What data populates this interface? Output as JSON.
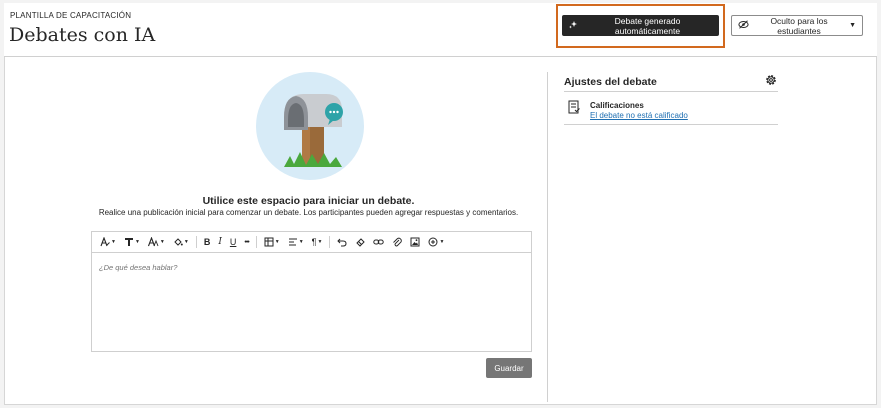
{
  "header": {
    "breadcrumb": "PLANTILLA DE CAPACITACIÓN",
    "title": "Debates con IA",
    "ai_button_label": "Debate generado automáticamente",
    "visibility_label": "Oculto para los estudiantes"
  },
  "main": {
    "prompt_title": "Utilice este espacio para iniciar un debate.",
    "prompt_subtitle": "Realice una publicación inicial para comenzar un debate. Los participantes pueden agregar respuestas y comentarios.",
    "editor_placeholder": "¿De qué desea hablar?",
    "toolbar": {
      "bold": "B",
      "italic": "I",
      "underline": "U",
      "more": "•••",
      "paragraph": "¶"
    },
    "save_label": "Guardar"
  },
  "settings": {
    "title": "Ajustes del debate",
    "grades_label": "Calificaciones",
    "grades_link": "El debate no está calificado"
  },
  "colors": {
    "highlight": "#d2691e",
    "primary_button": "#262626",
    "save_button": "#767676",
    "link": "#1f6fb2",
    "illustration_bg": "#d7ebf7"
  },
  "icons": [
    "sparkle-icon",
    "eye-slash-icon",
    "chevron-down-icon",
    "gear-icon",
    "gradebook-icon",
    "mailbox-illustration"
  ]
}
